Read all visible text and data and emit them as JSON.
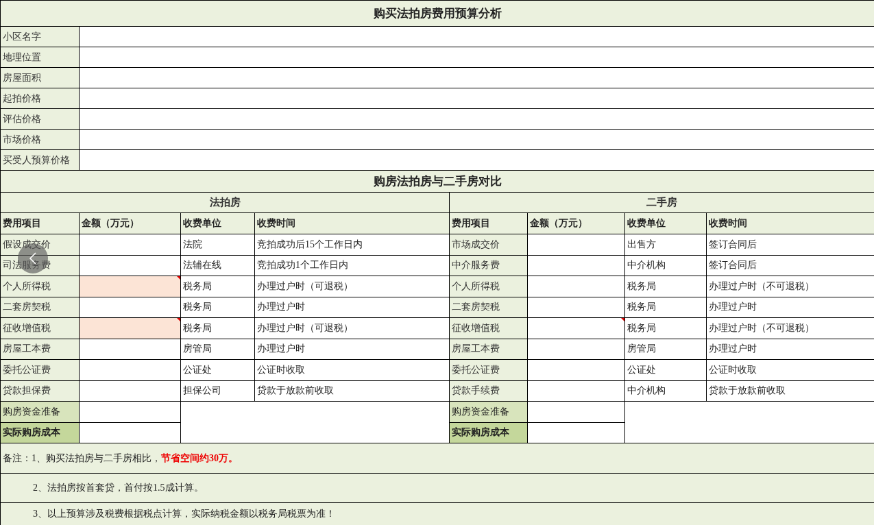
{
  "title": "购买法拍房费用预算分析",
  "info_labels": [
    "小区名字",
    "地理位置",
    "房屋面积",
    "起拍价格",
    "评估价格",
    "市场价格",
    "买受人预算价格"
  ],
  "comparison": {
    "title": "购房法拍房与二手房对比",
    "sections": [
      {
        "title": "法拍房",
        "columns": [
          "费用项目",
          "金额（万元）",
          "收费单位",
          "收费时间"
        ],
        "rows": [
          {
            "item": "假设成交价",
            "amount_highlighted": false,
            "amount_comment": false,
            "payee": "法院",
            "timing": "竞拍成功后15个工作日内"
          },
          {
            "item": "司法服务费",
            "amount_highlighted": false,
            "amount_comment": false,
            "payee": "法辅在线",
            "timing": "竞拍成功1个工作日内"
          },
          {
            "item": "个人所得税",
            "amount_highlighted": true,
            "amount_comment": true,
            "payee": "税务局",
            "timing": "办理过户时（可退税）"
          },
          {
            "item": "二套房契税",
            "amount_highlighted": false,
            "amount_comment": false,
            "payee": "税务局",
            "timing": "办理过户时"
          },
          {
            "item": "征收增值税",
            "amount_highlighted": true,
            "amount_comment": true,
            "payee": "税务局",
            "timing": "办理过户时（可退税）"
          },
          {
            "item": "房屋工本费",
            "amount_highlighted": false,
            "amount_comment": false,
            "payee": "房管局",
            "timing": "办理过户时"
          },
          {
            "item": "委托公证费",
            "amount_highlighted": false,
            "amount_comment": false,
            "payee": "公证处",
            "timing": "公证时收取"
          },
          {
            "item": "贷款担保费",
            "amount_highlighted": false,
            "amount_comment": false,
            "payee": "担保公司",
            "timing": "贷款于放款前收取"
          }
        ],
        "summary": [
          {
            "label": "购房资金准备",
            "kind": "subtotal"
          },
          {
            "label": "实际购房成本",
            "kind": "total"
          }
        ]
      },
      {
        "title": "二手房",
        "columns": [
          "费用项目",
          "金额（万元）",
          "收费单位",
          "收费时间"
        ],
        "rows": [
          {
            "item": "市场成交价",
            "amount_highlighted": false,
            "amount_comment": false,
            "payee": "出售方",
            "timing": "签订合同后"
          },
          {
            "item": "中介服务费",
            "amount_highlighted": false,
            "amount_comment": false,
            "payee": "中介机构",
            "timing": "签订合同后"
          },
          {
            "item": "个人所得税",
            "amount_highlighted": false,
            "amount_comment": false,
            "payee": "税务局",
            "timing": "办理过户时（不可退税）"
          },
          {
            "item": "二套房契税",
            "amount_highlighted": false,
            "amount_comment": false,
            "payee": "税务局",
            "timing": "办理过户时"
          },
          {
            "item": "征收增值税",
            "amount_highlighted": false,
            "amount_comment": true,
            "payee": "税务局",
            "timing": "办理过户时（不可退税）"
          },
          {
            "item": "房屋工本费",
            "amount_highlighted": false,
            "amount_comment": false,
            "payee": "房管局",
            "timing": "办理过户时"
          },
          {
            "item": "委托公证费",
            "amount_highlighted": false,
            "amount_comment": false,
            "payee": "公证处",
            "timing": "公证时收取"
          },
          {
            "item": "贷款手续费",
            "amount_highlighted": false,
            "amount_comment": false,
            "payee": "中介机构",
            "timing": "贷款于放款前收取"
          }
        ],
        "summary": [
          {
            "label": "购房资金准备",
            "kind": "subtotal"
          },
          {
            "label": "实际购房成本",
            "kind": "total"
          }
        ]
      }
    ]
  },
  "notes": [
    "备注：1、购买法拍房与二手房相比，**节省空间约30万。**",
    "2、法拍房按首套贷，首付按1.5成计算。",
    "3、以上预算涉及税费根据税点计算，实际纳税金额以税务局税票为准！"
  ]
}
